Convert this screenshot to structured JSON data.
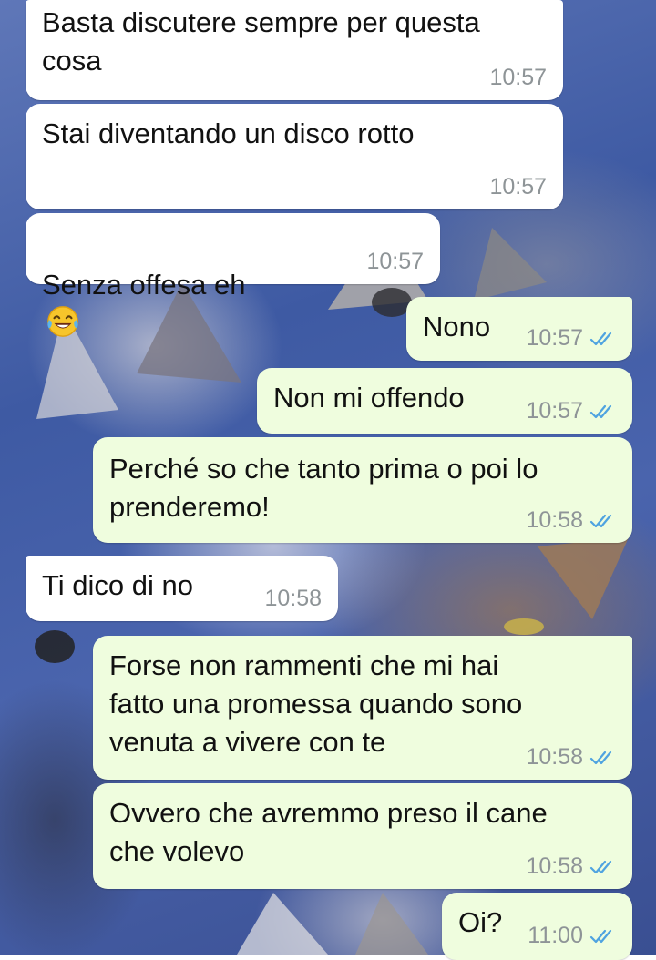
{
  "messages": [
    {
      "text": "Basta discutere sempre per questa\ncosa",
      "time": "10:57",
      "direction": "incoming"
    },
    {
      "text": "Stai diventando un disco rotto",
      "time": "10:57",
      "direction": "incoming"
    },
    {
      "text": "Senza offesa eh",
      "emoji": "face-with-tears-of-joy-icon",
      "time": "10:57",
      "direction": "incoming"
    },
    {
      "text": "Nono",
      "time": "10:57",
      "direction": "outgoing",
      "status": "read"
    },
    {
      "text": "Non mi offendo",
      "time": "10:57",
      "direction": "outgoing",
      "status": "read"
    },
    {
      "text": "Perché so che tanto prima o poi lo\nprenderemo!",
      "time": "10:58",
      "direction": "outgoing",
      "status": "read"
    },
    {
      "text": "Ti dico di no",
      "time": "10:58",
      "direction": "incoming"
    },
    {
      "text": "Forse non rammenti che mi hai\nfatto una promessa quando sono\nvenuta a vivere con te",
      "time": "10:58",
      "direction": "outgoing",
      "status": "read"
    },
    {
      "text": "Ovvero che avremmo preso il cane\nche volevo",
      "time": "10:58",
      "direction": "outgoing",
      "status": "read"
    },
    {
      "text": "Oi?",
      "time": "11:00",
      "direction": "outgoing",
      "status": "read"
    }
  ],
  "colors": {
    "incoming_bubble": "#ffffff",
    "outgoing_bubble": "#effdde",
    "read_ticks": "#4fa3e0",
    "time_text": "#8e9497"
  }
}
